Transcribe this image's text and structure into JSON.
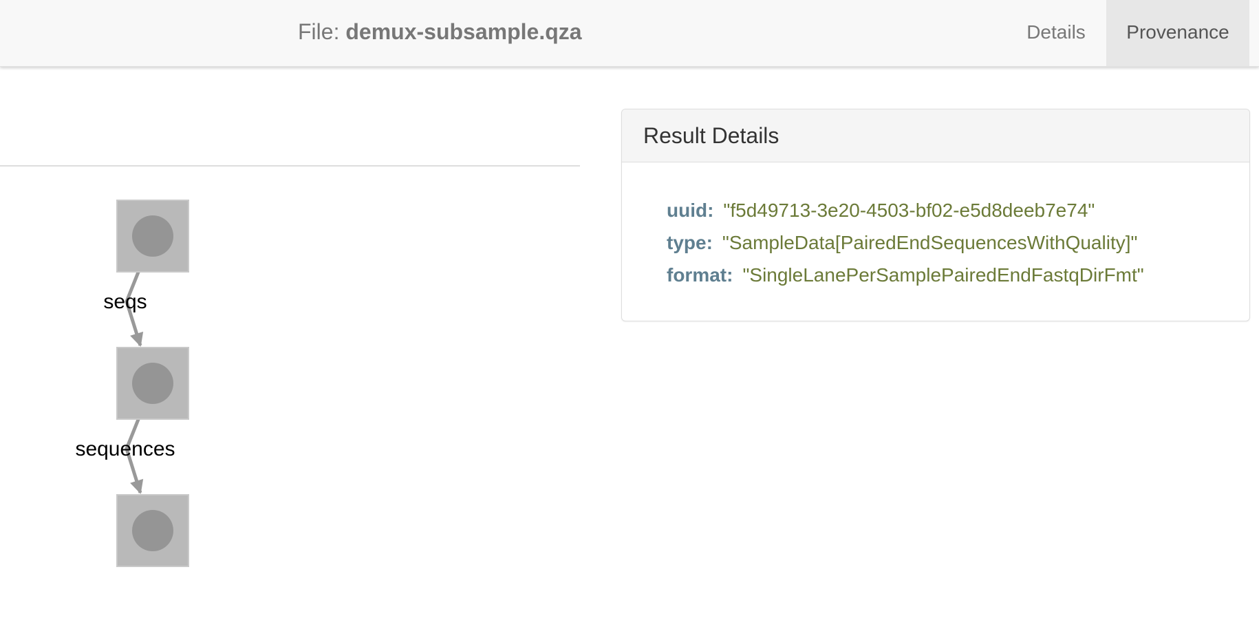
{
  "header": {
    "file_prefix": "File:",
    "file_name": "demux-subsample.qza",
    "tabs": [
      {
        "label": "Details",
        "active": false
      },
      {
        "label": "Provenance",
        "active": true
      }
    ]
  },
  "graph": {
    "nodes": [
      {
        "name": "result-node-1"
      },
      {
        "name": "action-node"
      },
      {
        "name": "result-node-2"
      }
    ],
    "edges": [
      {
        "label": "seqs"
      },
      {
        "label": "sequences"
      }
    ]
  },
  "result_details": {
    "title": "Result Details",
    "rows": [
      {
        "key": "uuid:",
        "value": "\"f5d49713-3e20-4503-bf02-e5d8deeb7e74\""
      },
      {
        "key": "type:",
        "value": "\"SampleData[PairedEndSequencesWithQuality]\""
      },
      {
        "key": "format:",
        "value": "\"SingleLanePerSamplePairedEndFastqDirFmt\""
      }
    ]
  },
  "colors": {
    "node_fill": "#b9b9b9",
    "node_border": "#c9c9c9",
    "node_circle": "#959595",
    "edge": "#999999",
    "key": "#5f7f90",
    "value": "#6b7a38"
  }
}
